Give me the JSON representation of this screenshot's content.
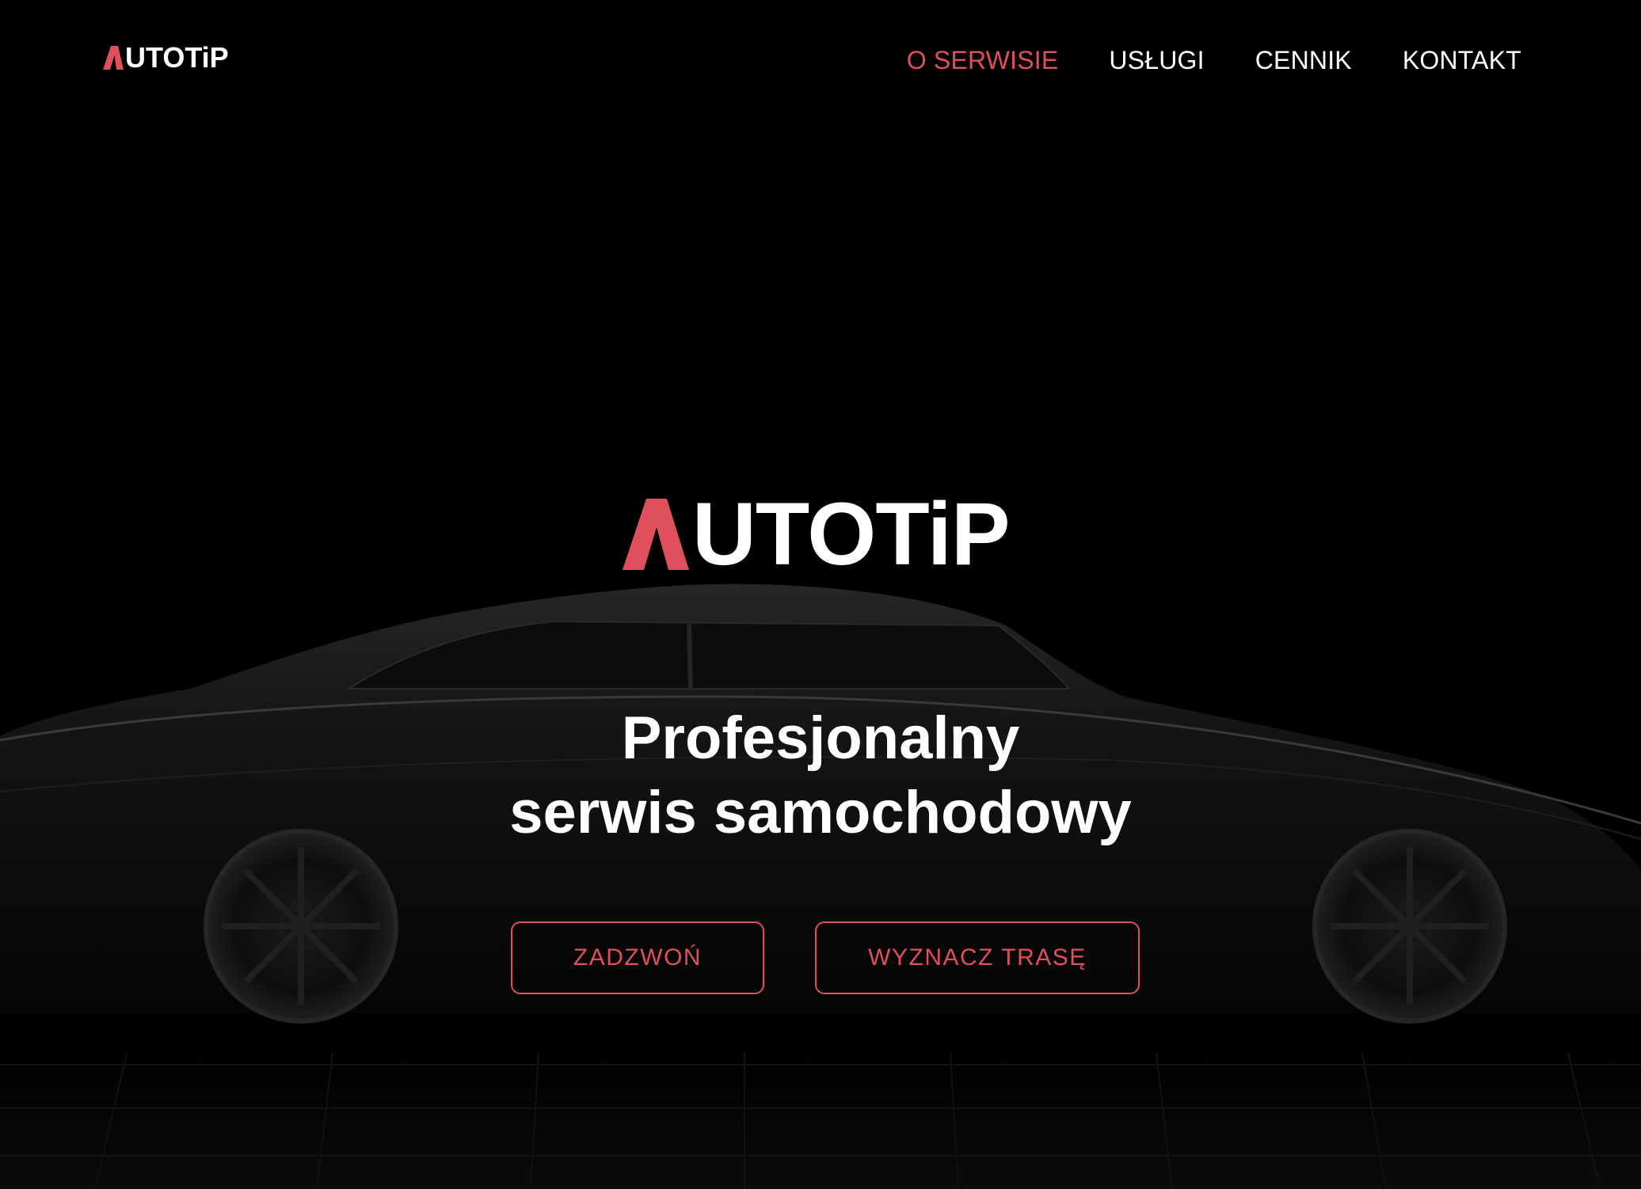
{
  "brand": {
    "name": "UTOTiP",
    "accent_color": "#e0505c"
  },
  "nav": {
    "items": [
      {
        "label": "O SERWISIE",
        "active": true
      },
      {
        "label": "USŁUGI",
        "active": false
      },
      {
        "label": "CENNIK",
        "active": false
      },
      {
        "label": "KONTAKT",
        "active": false
      }
    ]
  },
  "hero": {
    "headline_line1": "Profesjonalny",
    "headline_line2": "serwis samochodowy",
    "buttons": {
      "call_label": "ZADZWOŃ",
      "route_label": "WYZNACZ TRASĘ"
    }
  }
}
